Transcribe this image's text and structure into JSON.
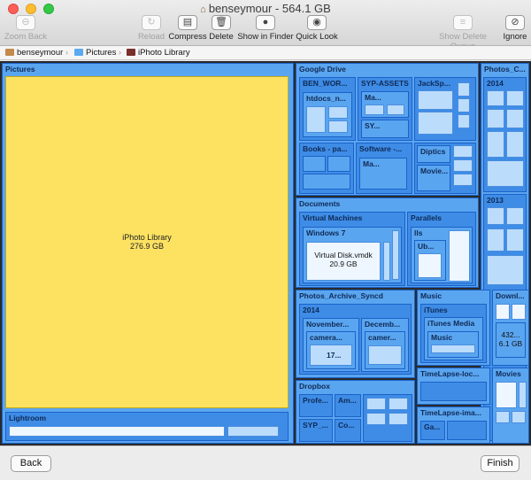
{
  "window": {
    "title": "benseymour - 564.1 GB",
    "home_icon": "home-icon"
  },
  "toolbar": {
    "zoom_back": "Zoom Back",
    "reload": "Reload",
    "compress": "Compress",
    "delete": "Delete",
    "show_in_finder": "Show in Finder",
    "quick_look": "Quick Look",
    "show_delete_queue": "Show Delete Queue",
    "ignore": "Ignore"
  },
  "path": {
    "items": [
      "benseymour",
      "Pictures",
      "iPhoto Library"
    ]
  },
  "map": {
    "pictures": "Pictures",
    "iphoto_name": "iPhoto Library",
    "iphoto_size": "276.9 GB",
    "lightroom": "Lightroom",
    "google_drive": "Google Drive",
    "ben_wor": "BEN_WOR...",
    "htdocs": "htdocs_n...",
    "syp_assets": "SYP-ASSETS",
    "ma1": "Ma...",
    "sy": "SY...",
    "jacksp": "JackSp...",
    "books": "Books - pa...",
    "software": "Software -...",
    "ma2": "Ma...",
    "diptics": "Diptics",
    "movie": "Movie...",
    "photos_c": "Photos_C...",
    "y2014a": "2014",
    "y2013": "2013",
    "documents": "Documents",
    "virtual_machines": "Virtual Machines",
    "windows7": "Windows 7",
    "vmdk_name": "Virtual Disk.vmdk",
    "vmdk_size": "20.9 GB",
    "parallels": "Parallels",
    "lls": "lls",
    "ub": "Ub...",
    "photos_archive": "Photos_Archive_Syncd",
    "y2014b": "2014",
    "november": "November...",
    "december": "Decemb...",
    "camera1": "camera...",
    "camera2": "camer...",
    "n17": "17...",
    "music": "Music",
    "itunes": "iTunes",
    "itunes_media": "iTunes Media",
    "music2": "Music",
    "downloads": "Downl...",
    "dl_size_a": "432...",
    "dl_size_b": "6.1 GB",
    "timelapse_loc": "TimeLapse-loc...",
    "movies": "Movies",
    "timelapse_ima": "TimeLapse-ima...",
    "ga": "Ga...",
    "dropbox": "Dropbox",
    "profe": "Profe...",
    "am": "Am...",
    "syp": "SYP_...",
    "co": "Co..."
  },
  "footer": {
    "back": "Back",
    "finish": "Finish"
  }
}
